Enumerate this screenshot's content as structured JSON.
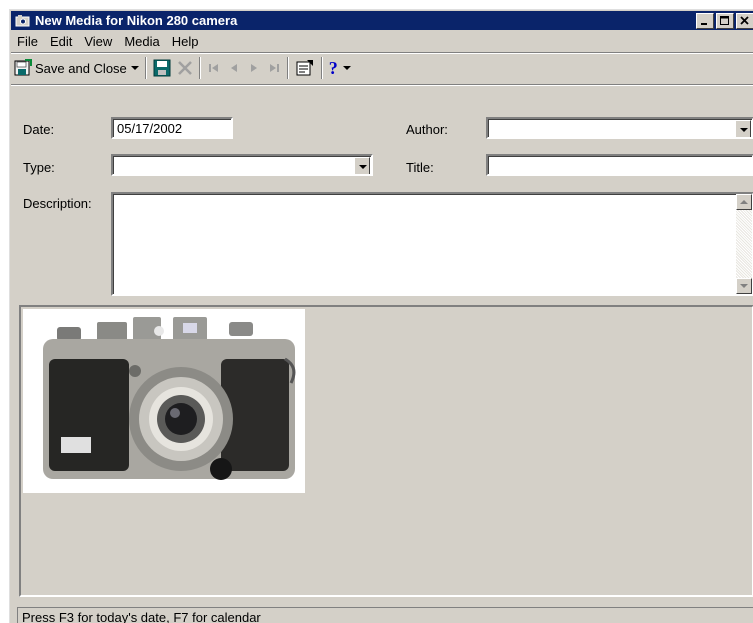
{
  "window": {
    "title": "New Media for Nikon 280 camera",
    "controls": {
      "minimize": "_",
      "maximize": "□",
      "close": "×"
    }
  },
  "menu": [
    {
      "label": "File"
    },
    {
      "label": "Edit"
    },
    {
      "label": "View"
    },
    {
      "label": "Media"
    },
    {
      "label": "Help"
    }
  ],
  "toolbar": {
    "save_close_label": "Save and Close",
    "help_label": "?"
  },
  "form": {
    "date_label": "Date:",
    "date_value": "05/17/2002",
    "author_label": "Author:",
    "author_value": "",
    "type_label": "Type:",
    "type_value": "",
    "title_label": "Title:",
    "title_value": "",
    "description_label": "Description:",
    "description_value": ""
  },
  "status": {
    "text": "Press F3 for today's date, F7 for calendar"
  },
  "colors": {
    "titlebar": "#0a246a",
    "face": "#d4d0c8",
    "help_blue": "#0000c8"
  }
}
